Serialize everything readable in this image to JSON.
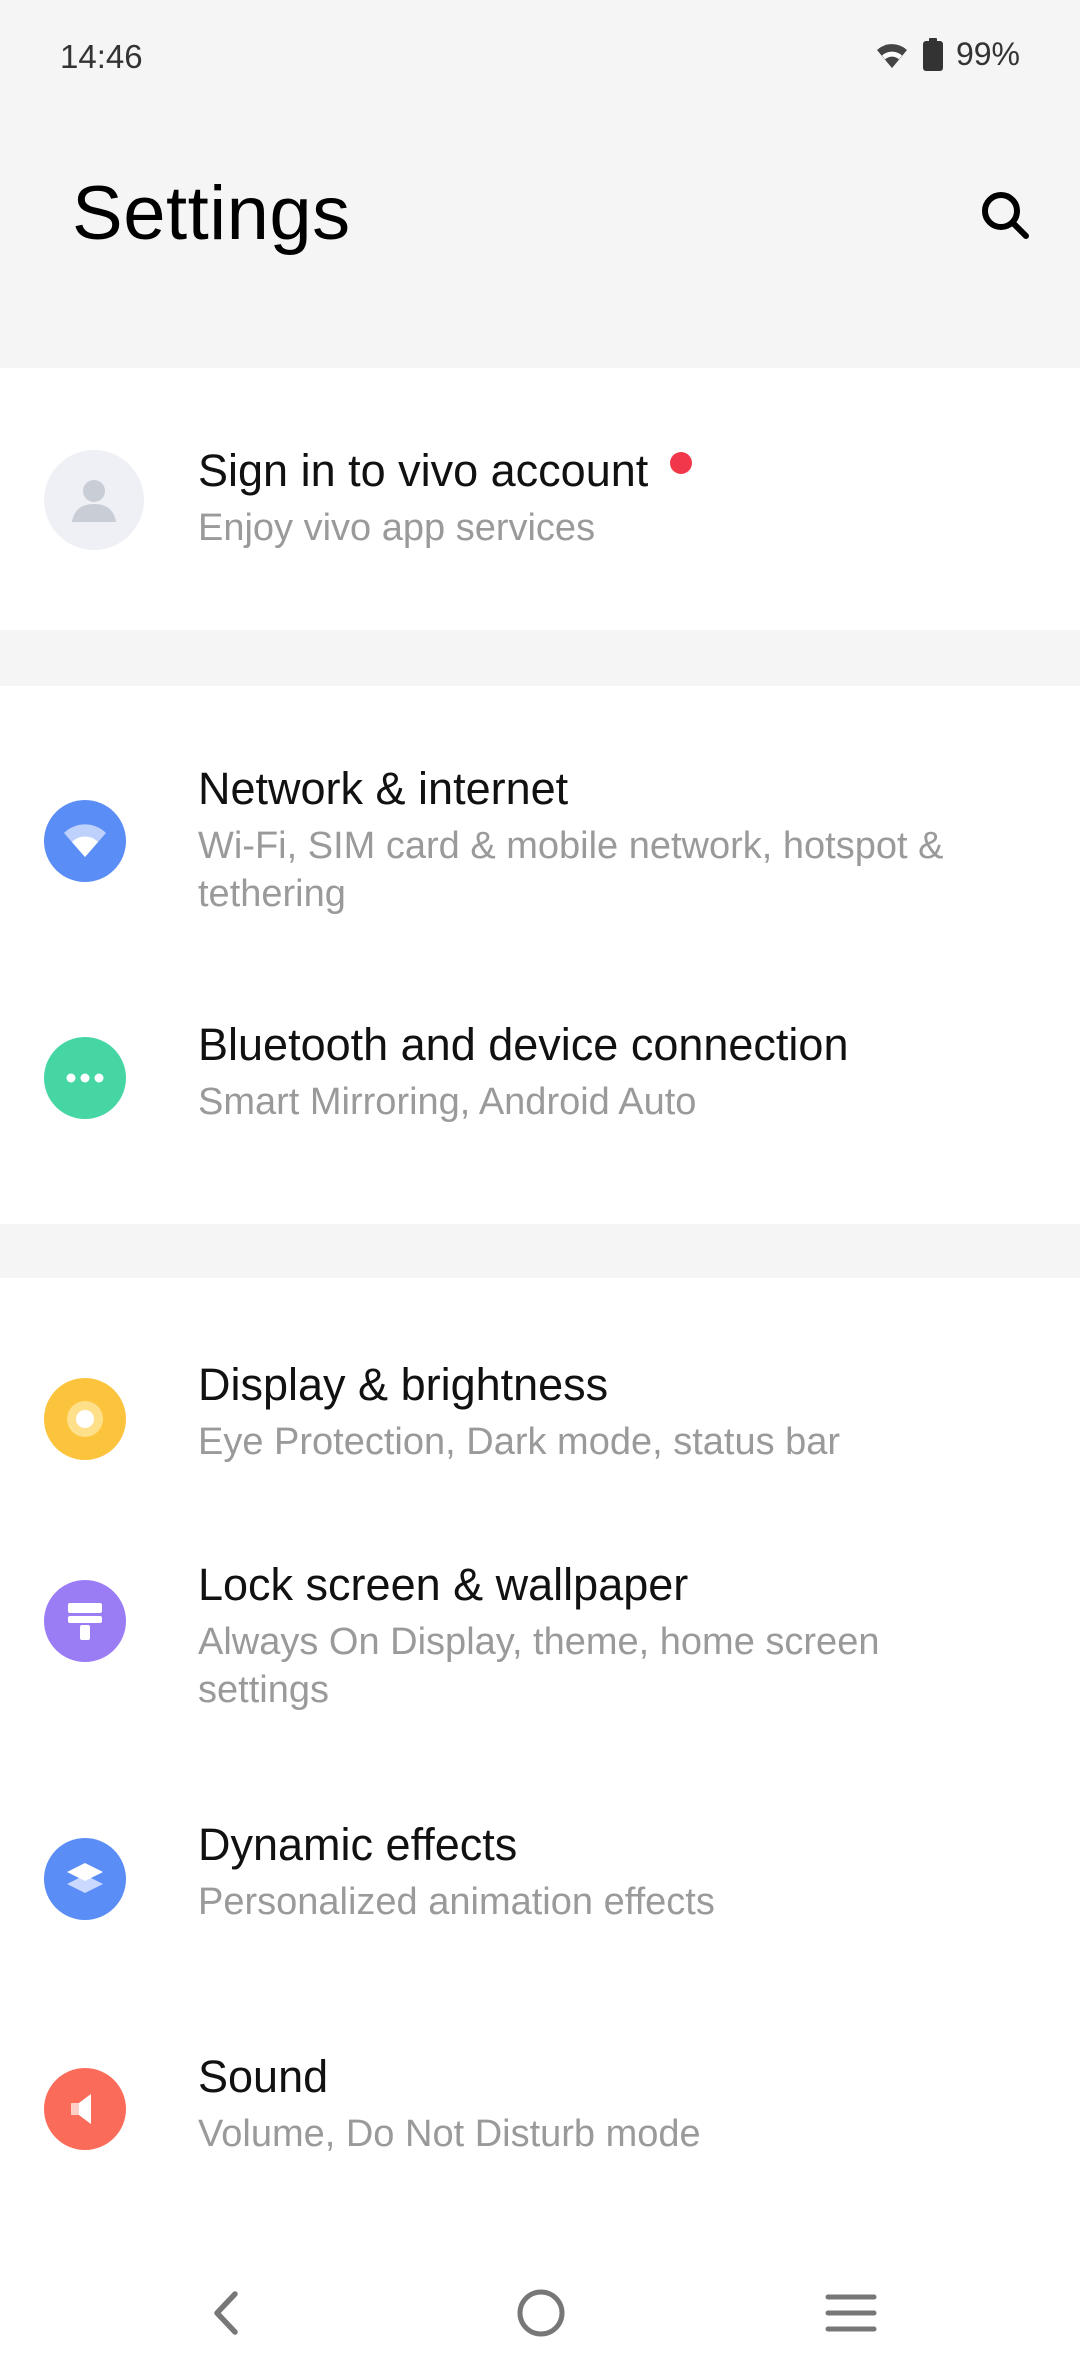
{
  "status_bar": {
    "time": "14:46",
    "battery": "99%",
    "icons": [
      "wifi-icon",
      "battery-icon"
    ]
  },
  "header": {
    "title": "Settings",
    "search_icon": "search-icon"
  },
  "account": {
    "title": "Sign in to vivo account",
    "subtitle": "Enjoy vivo app services",
    "icon": "avatar-icon",
    "badge_color": "#f2374b"
  },
  "groups": [
    {
      "items": [
        {
          "title": "Network & internet",
          "subtitle": "Wi-Fi, SIM card & mobile network, hotspot & tethering",
          "icon": "wifi-icon",
          "color": "#5b8df6"
        },
        {
          "title": "Bluetooth and device connection",
          "subtitle": "Smart Mirroring, Android Auto",
          "icon": "more-dots-icon",
          "color": "#46d6a4"
        }
      ]
    },
    {
      "items": [
        {
          "title": "Display & brightness",
          "subtitle": "Eye Protection, Dark mode, status bar",
          "icon": "brightness-icon",
          "color": "#fcc33c"
        },
        {
          "title": "Lock screen & wallpaper",
          "subtitle": "Always On Display, theme, home screen settings",
          "icon": "paint-roller-icon",
          "color": "#9a7cf5"
        },
        {
          "title": "Dynamic effects",
          "subtitle": "Personalized animation effects",
          "icon": "layers-icon",
          "color": "#5b8df6"
        },
        {
          "title": "Sound",
          "subtitle": "Volume, Do Not Disturb mode",
          "icon": "speaker-icon",
          "color": "#fa6b5a"
        }
      ]
    }
  ],
  "nav": {
    "back_icon": "back-icon",
    "home_icon": "home-icon",
    "menu_icon": "menu-icon"
  }
}
